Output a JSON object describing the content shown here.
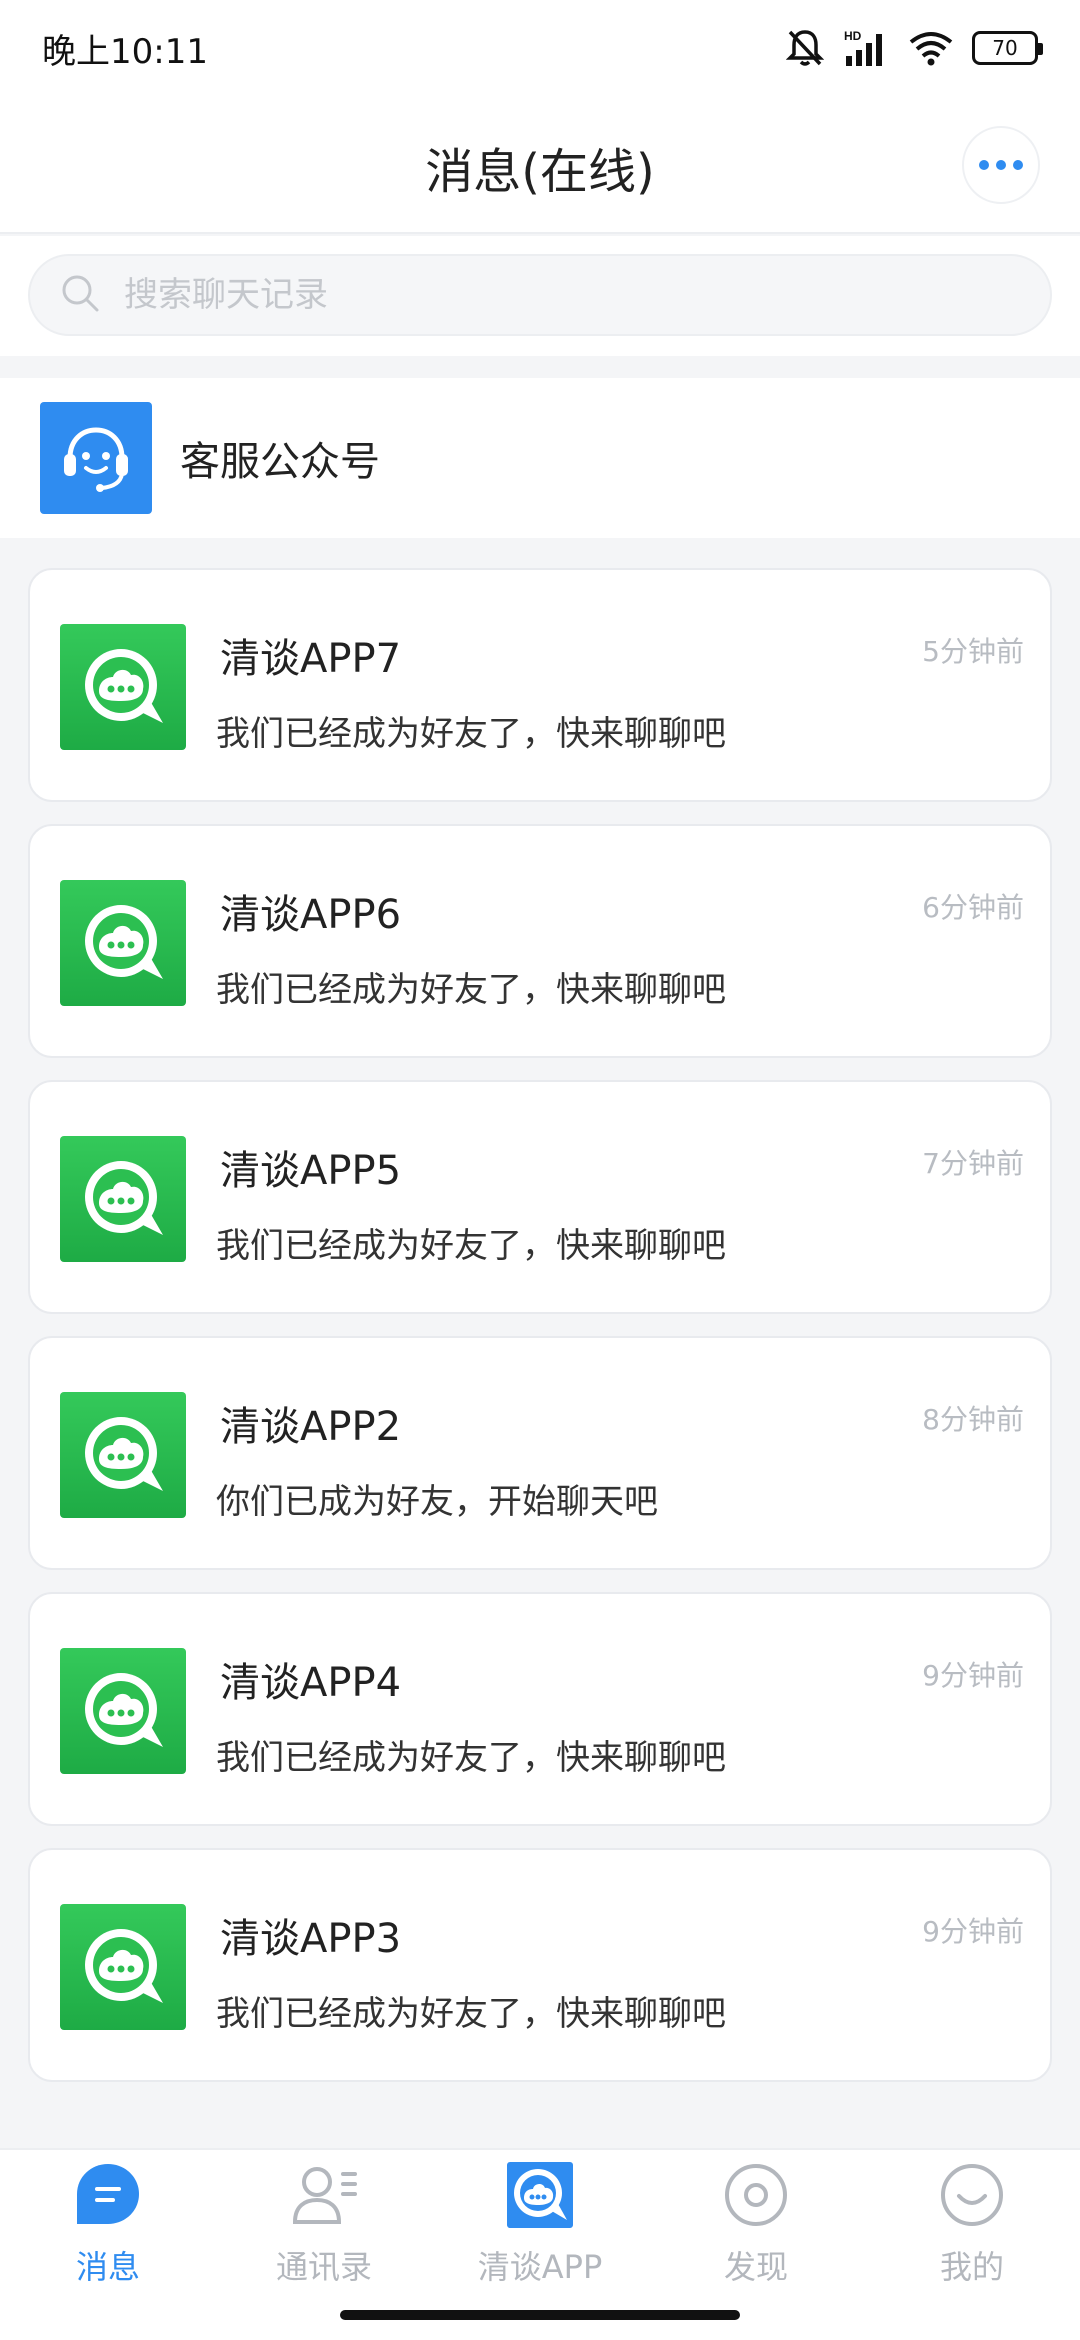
{
  "status_bar": {
    "time": "晚上10:11",
    "network": "HD",
    "battery": "70"
  },
  "header": {
    "title": "消息(在线)"
  },
  "search": {
    "placeholder": "搜索聊天记录"
  },
  "service_account": {
    "label": "客服公众号"
  },
  "chats": [
    {
      "name": "清谈APP7",
      "message": "我们已经成为好友了，快来聊聊吧",
      "time": "5分钟前"
    },
    {
      "name": "清谈APP6",
      "message": "我们已经成为好友了，快来聊聊吧",
      "time": "6分钟前"
    },
    {
      "name": "清谈APP5",
      "message": "我们已经成为好友了，快来聊聊吧",
      "time": "7分钟前"
    },
    {
      "name": "清谈APP2",
      "message": "你们已成为好友，开始聊天吧",
      "time": "8分钟前"
    },
    {
      "name": "清谈APP4",
      "message": "我们已经成为好友了，快来聊聊吧",
      "time": "9分钟前"
    },
    {
      "name": "清谈APP3",
      "message": "我们已经成为好友了，快来聊聊吧",
      "time": "9分钟前"
    }
  ],
  "bottom_nav": [
    {
      "label": "消息",
      "icon": "message-icon",
      "active": true
    },
    {
      "label": "通讯录",
      "icon": "contacts-icon",
      "active": false
    },
    {
      "label": "清谈APP",
      "icon": "app-logo-icon",
      "active": false
    },
    {
      "label": "发现",
      "icon": "discover-icon",
      "active": false
    },
    {
      "label": "我的",
      "icon": "profile-icon",
      "active": false
    }
  ],
  "colors": {
    "accent": "#2f8cf0",
    "app_green": "#2cbf51",
    "muted": "#b3b7bd"
  }
}
